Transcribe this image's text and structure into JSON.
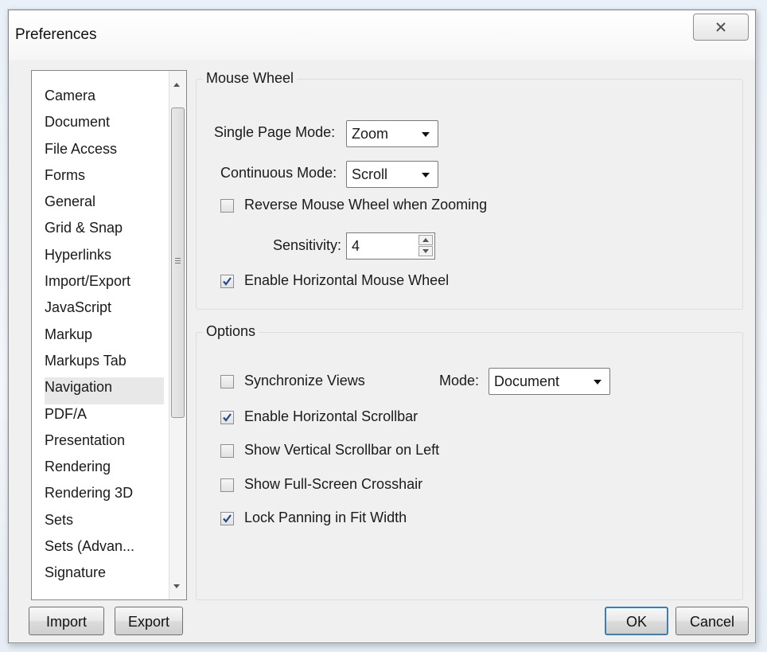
{
  "dialog": {
    "title": "Preferences"
  },
  "categories": [
    "Camera",
    "Document",
    "File Access",
    "Forms",
    "General",
    "Grid & Snap",
    "Hyperlinks",
    "Import/Export",
    "JavaScript",
    "Markup",
    "Markups Tab",
    "Navigation",
    "PDF/A",
    "Presentation",
    "Rendering",
    "Rendering 3D",
    "Sets",
    "Sets (Advan...",
    "Signature"
  ],
  "selected_category": "Navigation",
  "mouse_wheel": {
    "title": "Mouse Wheel",
    "single_page_label": "Single Page Mode:",
    "single_page_value": "Zoom",
    "continuous_label": "Continuous Mode:",
    "continuous_value": "Scroll",
    "reverse_label": "Reverse Mouse Wheel when Zooming",
    "reverse_checked": false,
    "sensitivity_label": "Sensitivity:",
    "sensitivity_value": "4",
    "horizontal_label": "Enable Horizontal Mouse Wheel",
    "horizontal_checked": true
  },
  "options": {
    "title": "Options",
    "sync_label": "Synchronize Views",
    "sync_checked": false,
    "mode_label": "Mode:",
    "mode_value": "Document",
    "hscroll_label": "Enable Horizontal Scrollbar",
    "hscroll_checked": true,
    "vscroll_left_label": "Show Vertical Scrollbar on Left",
    "vscroll_left_checked": false,
    "crosshair_label": "Show Full-Screen Crosshair",
    "crosshair_checked": false,
    "lock_label": "Lock Panning in Fit Width",
    "lock_checked": true
  },
  "buttons": {
    "import": "Import",
    "export": "Export",
    "ok": "OK",
    "cancel": "Cancel"
  }
}
